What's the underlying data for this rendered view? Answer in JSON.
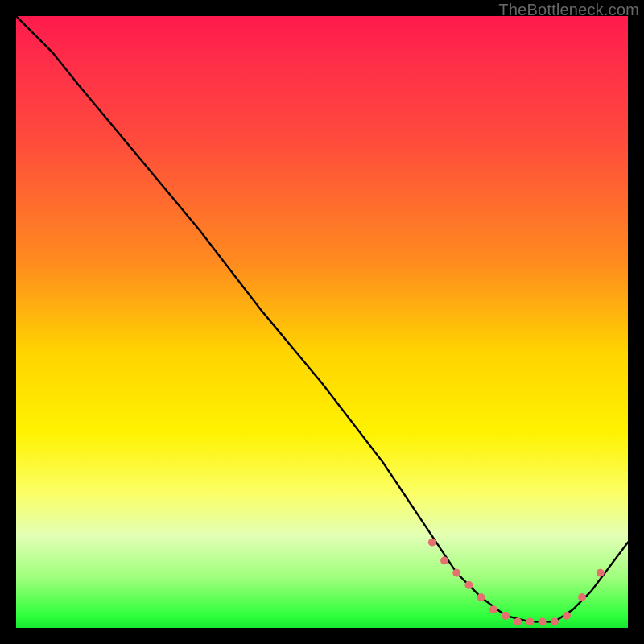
{
  "watermark": "TheBottleneck.com",
  "chart_data": {
    "type": "line",
    "title": "",
    "xlabel": "",
    "ylabel": "",
    "xlim": [
      0,
      100
    ],
    "ylim": [
      0,
      100
    ],
    "grid": false,
    "series": [
      {
        "name": "curve",
        "x": [
          0,
          6,
          10,
          20,
          30,
          40,
          50,
          60,
          68,
          72,
          76,
          80,
          84,
          88,
          91,
          94,
          97,
          100
        ],
        "y": [
          100,
          94,
          89,
          77,
          65,
          52,
          40,
          27,
          15,
          9,
          5,
          2,
          1,
          1,
          3,
          6,
          10,
          14
        ]
      }
    ],
    "markers": {
      "name": "dots",
      "x": [
        68,
        70,
        72,
        74,
        76,
        78,
        80,
        82,
        84,
        86,
        88,
        90,
        92.5,
        95.5
      ],
      "y": [
        14,
        11,
        9,
        7,
        5,
        3,
        2,
        1,
        1,
        1,
        1,
        2,
        5,
        9
      ],
      "color": "#e4706f",
      "radius_px": 5
    }
  }
}
